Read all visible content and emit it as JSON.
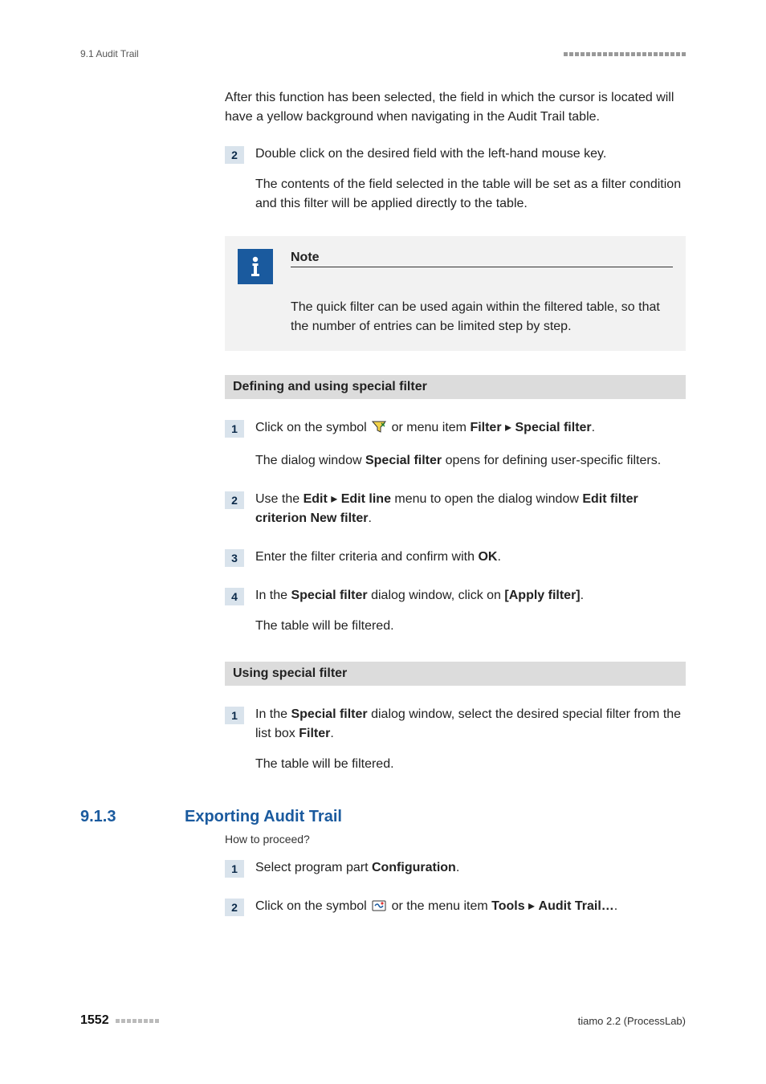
{
  "header": {
    "section_label": "9.1 Audit Trail"
  },
  "intro_paragraph": "After this function has been selected, the field in which the cursor is located will have a yellow background when navigating in the Audit Trail table.",
  "quick_step": {
    "num": "2",
    "line1": "Double click on the desired field with the left-hand mouse key.",
    "line2": "The contents of the field selected in the table will be set as a filter condition and this filter will be applied directly to the table."
  },
  "note": {
    "title": "Note",
    "text": "The quick filter can be used again within the filtered table, so that the number of entries can be limited step by step."
  },
  "section1": {
    "title": "Defining and using special filter",
    "steps": {
      "s1": {
        "num": "1",
        "prefix": "Click on the symbol ",
        "mid": " or menu item ",
        "menu1": "Filter",
        "menu2": "Special filter",
        "after": ".",
        "p2a": "The dialog window ",
        "p2b": "Special filter",
        "p2c": " opens for defining user-specific filters."
      },
      "s2": {
        "num": "2",
        "a": "Use the ",
        "b": "Edit",
        "c": "Edit line",
        "d": " menu to open the dialog window ",
        "e": "Edit filter criterion New filter",
        "f": "."
      },
      "s3": {
        "num": "3",
        "a": "Enter the filter criteria and confirm with ",
        "b": "OK",
        "c": "."
      },
      "s4": {
        "num": "4",
        "a": "In the ",
        "b": "Special filter",
        "c": " dialog window, click on ",
        "d": "[Apply filter]",
        "e": ".",
        "p2": "The table will be filtered."
      }
    }
  },
  "section2": {
    "title": "Using special filter",
    "s1": {
      "num": "1",
      "a": "In the ",
      "b": "Special filter",
      "c": " dialog window, select the desired special filter from the list box ",
      "d": "Filter",
      "e": ".",
      "p2": "The table will be filtered."
    }
  },
  "subheading": {
    "num": "9.1.3",
    "title": "Exporting Audit Trail",
    "howto": "How to proceed?",
    "s1": {
      "num": "1",
      "a": "Select program part ",
      "b": "Configuration",
      "c": "."
    },
    "s2": {
      "num": "2",
      "a": "Click on the symbol ",
      "b": " or the menu item ",
      "c": "Tools",
      "d": "Audit Trail…",
      "e": "."
    }
  },
  "footer": {
    "page": "1552",
    "right": "tiamo 2.2 (ProcessLab)"
  }
}
